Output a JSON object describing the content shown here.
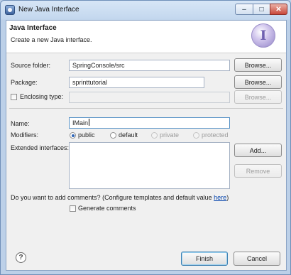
{
  "window": {
    "title": "New Java Interface",
    "controls": {
      "minimize": "–",
      "maximize": "□",
      "close": "✕"
    }
  },
  "header": {
    "title": "Java Interface",
    "subtitle": "Create a new Java interface.",
    "icon_letter": "I"
  },
  "form": {
    "source_folder": {
      "label": "Source folder:",
      "value": "SpringConsole/src",
      "button": "Browse..."
    },
    "package": {
      "label": "Package:",
      "value": "sprinttutorial",
      "button": "Browse..."
    },
    "enclosing_type": {
      "label": "Enclosing type:",
      "value": "",
      "button": "Browse..."
    },
    "name": {
      "label": "Name:",
      "value": "IMain"
    },
    "modifiers": {
      "label": "Modifiers:",
      "options": [
        "public",
        "default",
        "private",
        "protected"
      ],
      "selected": "public"
    },
    "extended_interfaces": {
      "label": "Extended interfaces:",
      "add_button": "Add...",
      "remove_button": "Remove"
    },
    "comments": {
      "prompt": "Do you want to add comments? (Configure templates and default value ",
      "link": "here",
      "suffix": ")",
      "checkbox_label": "Generate comments"
    }
  },
  "footer": {
    "finish": "Finish",
    "cancel": "Cancel",
    "help_icon": "?"
  },
  "colors": {
    "accent": "#3c7fb1",
    "link": "#0645ad",
    "title_bar": "#c3d7ee"
  }
}
